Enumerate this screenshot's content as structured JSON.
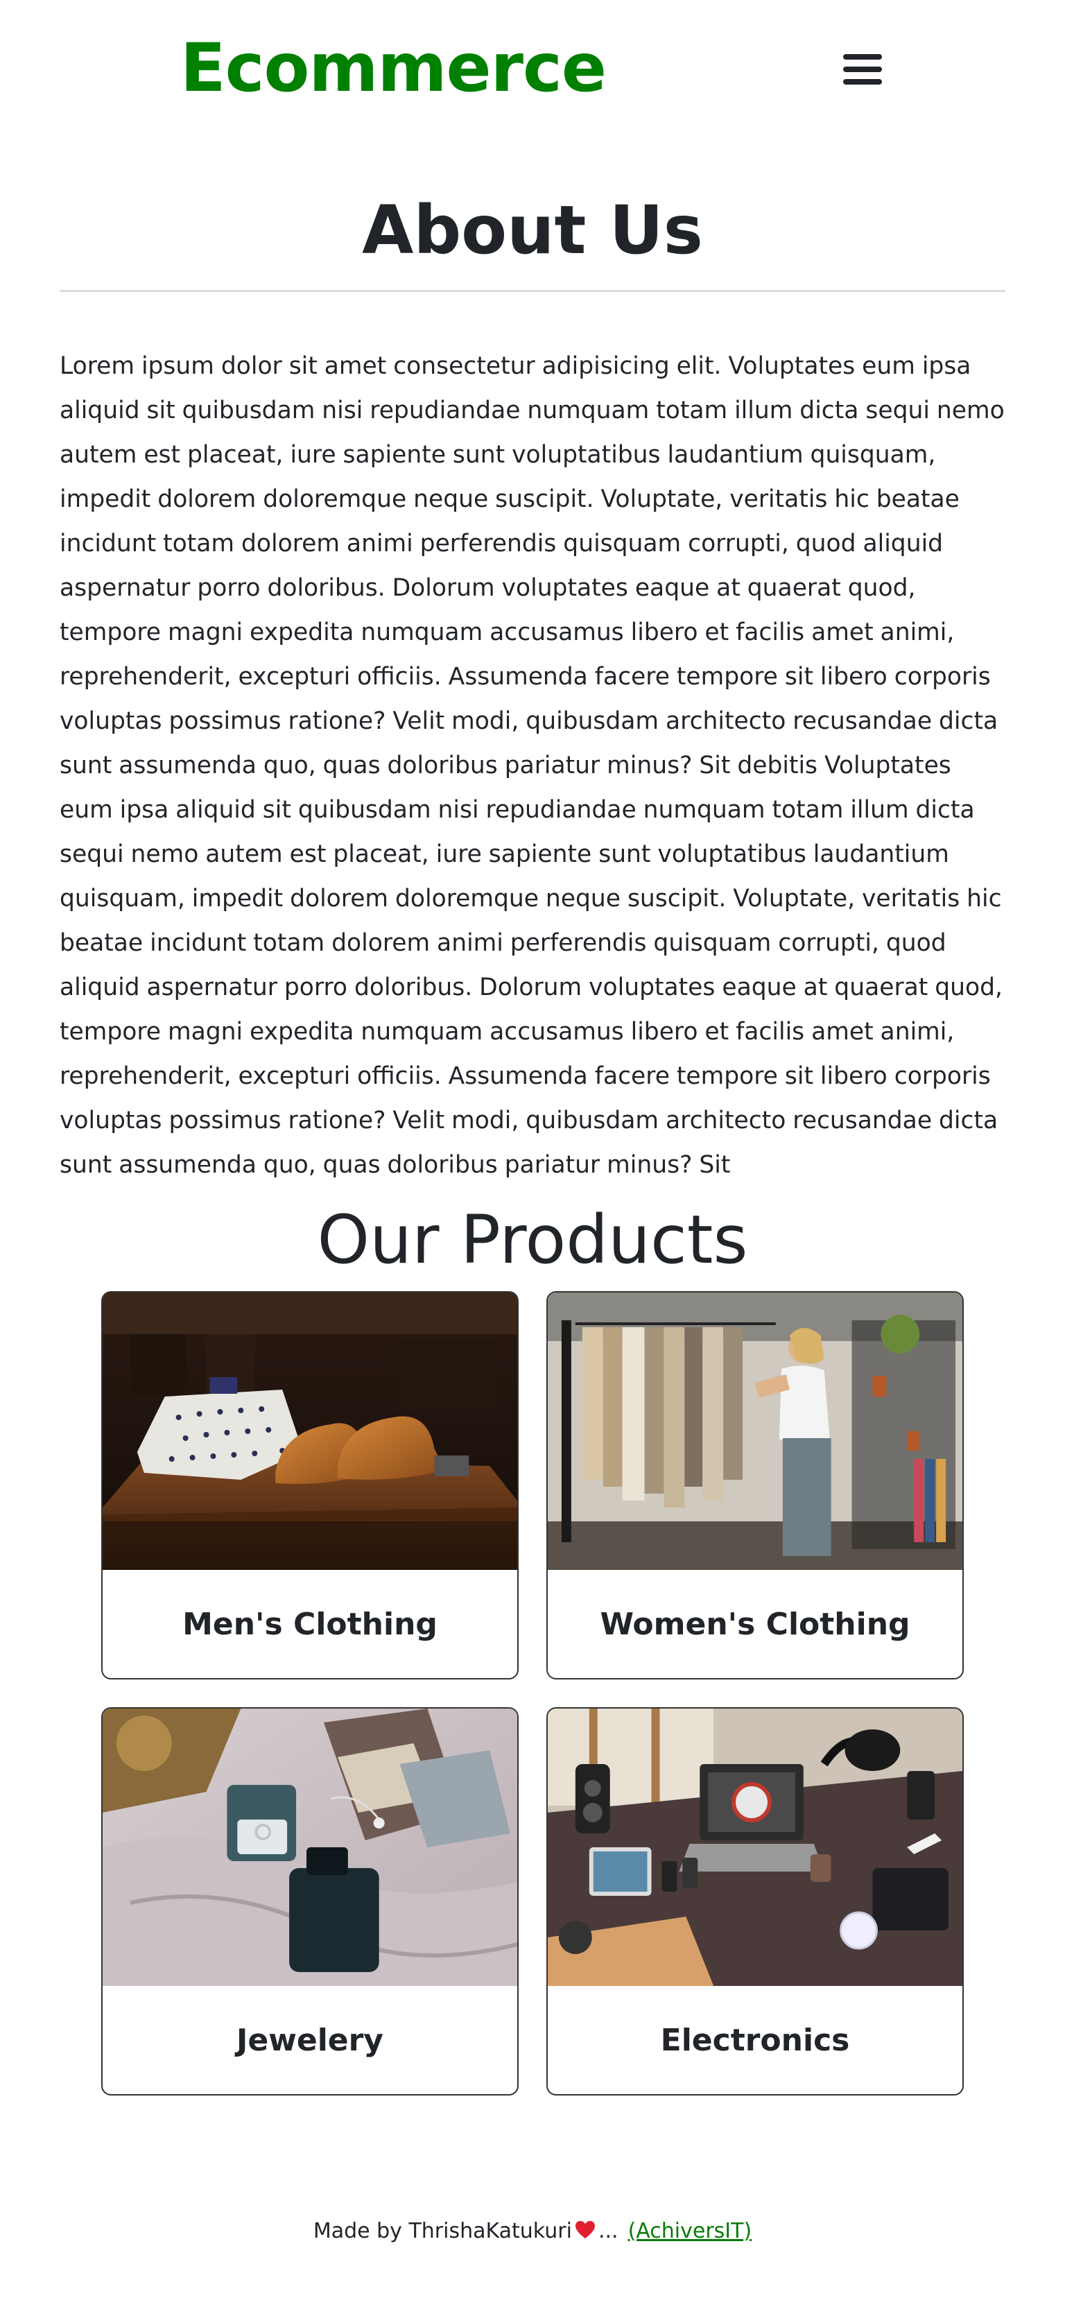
{
  "navbar": {
    "brand": "Ecommerce",
    "menu_icon": "hamburger-menu-icon"
  },
  "about": {
    "title": "About Us",
    "text": "Lorem ipsum dolor sit amet consectetur adipisicing elit. Voluptates eum ipsa aliquid sit quibusdam nisi repudiandae numquam totam illum dicta sequi nemo autem est placeat, iure sapiente sunt voluptatibus laudantium quisquam, impedit dolorem doloremque neque suscipit. Voluptate, veritatis hic beatae incidunt totam dolorem animi perferendis quisquam corrupti, quod aliquid aspernatur porro doloribus. Dolorum voluptates eaque at quaerat quod, tempore magni expedita numquam accusamus libero et facilis amet animi, reprehenderit, excepturi officiis. Assumenda facere tempore sit libero corporis voluptas possimus ratione? Velit modi, quibusdam architecto recusandae dicta sunt assumenda quo, quas doloribus pariatur minus? Sit debitis Voluptates eum ipsa aliquid sit quibusdam nisi repudiandae numquam totam illum dicta sequi nemo autem est placeat, iure sapiente sunt voluptatibus laudantium quisquam, impedit dolorem doloremque neque suscipit. Voluptate, veritatis hic beatae incidunt totam dolorem animi perferendis quisquam corrupti, quod aliquid aspernatur porro doloribus. Dolorum voluptates eaque at quaerat quod, tempore magni expedita numquam accusamus libero et facilis amet animi, reprehenderit, excepturi officiis. Assumenda facere tempore sit libero corporis voluptas possimus ratione? Velit modi, quibusdam architecto recusandae dicta sunt assumenda quo, quas doloribus pariatur minus? Sit"
  },
  "products": {
    "title": "Our Products",
    "items": [
      {
        "label": "Men's Clothing"
      },
      {
        "label": "Women's Clothing"
      },
      {
        "label": "Jewelery"
      },
      {
        "label": "Electronics"
      }
    ]
  },
  "footer": {
    "made_by": "Made by ThrishaKatukuri",
    "ellipsis": "...",
    "link": "(AchiversIT)"
  },
  "colors": {
    "brand": "#008000",
    "text": "#212529",
    "link": "#0a7a0a",
    "heart": "#e0202f"
  }
}
